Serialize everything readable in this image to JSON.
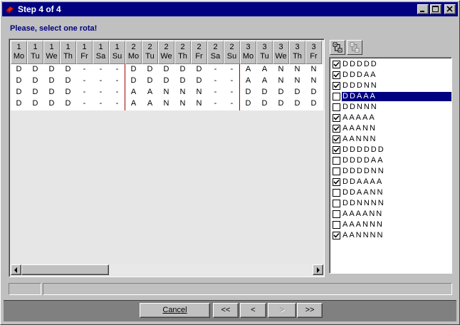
{
  "window": {
    "title": "Step 4 of 4"
  },
  "instruction": "Please, select one rota!",
  "grid": {
    "headers": [
      {
        "week": "1",
        "day": "Mo"
      },
      {
        "week": "1",
        "day": "Tu"
      },
      {
        "week": "1",
        "day": "We"
      },
      {
        "week": "1",
        "day": "Th"
      },
      {
        "week": "1",
        "day": "Fr"
      },
      {
        "week": "1",
        "day": "Sa"
      },
      {
        "week": "1",
        "day": "Su"
      },
      {
        "week": "2",
        "day": "Mo"
      },
      {
        "week": "2",
        "day": "Tu"
      },
      {
        "week": "2",
        "day": "We"
      },
      {
        "week": "2",
        "day": "Th"
      },
      {
        "week": "2",
        "day": "Fr"
      },
      {
        "week": "2",
        "day": "Sa"
      },
      {
        "week": "2",
        "day": "Su"
      },
      {
        "week": "3",
        "day": "Mo"
      },
      {
        "week": "3",
        "day": "Tu"
      },
      {
        "week": "3",
        "day": "We"
      },
      {
        "week": "3",
        "day": "Th"
      },
      {
        "week": "3",
        "day": "Fr"
      }
    ],
    "rows": [
      [
        "D",
        "D",
        "D",
        "D",
        "-",
        "-",
        "-",
        "D",
        "D",
        "D",
        "D",
        "D",
        "-",
        "-",
        "A",
        "A",
        "N",
        "N",
        "N"
      ],
      [
        "D",
        "D",
        "D",
        "D",
        "-",
        "-",
        "-",
        "D",
        "D",
        "D",
        "D",
        "D",
        "-",
        "-",
        "A",
        "A",
        "N",
        "N",
        "N"
      ],
      [
        "D",
        "D",
        "D",
        "D",
        "-",
        "-",
        "-",
        "A",
        "A",
        "N",
        "N",
        "N",
        "-",
        "-",
        "D",
        "D",
        "D",
        "D",
        "D"
      ],
      [
        "D",
        "D",
        "D",
        "D",
        "-",
        "-",
        "-",
        "A",
        "A",
        "N",
        "N",
        "N",
        "-",
        "-",
        "D",
        "D",
        "D",
        "D",
        "D"
      ]
    ]
  },
  "rotas": [
    {
      "label": "DDDDD",
      "checked": true,
      "selected": false
    },
    {
      "label": "DDDAA",
      "checked": true,
      "selected": false
    },
    {
      "label": "DDDNN",
      "checked": true,
      "selected": false
    },
    {
      "label": "DDAAA",
      "checked": false,
      "selected": true
    },
    {
      "label": "DDNNN",
      "checked": false,
      "selected": false
    },
    {
      "label": "AAAAA",
      "checked": true,
      "selected": false
    },
    {
      "label": "AAANN",
      "checked": true,
      "selected": false
    },
    {
      "label": "AANNN",
      "checked": true,
      "selected": false
    },
    {
      "label": "DDDDDD",
      "checked": true,
      "selected": false
    },
    {
      "label": "DDDDAA",
      "checked": false,
      "selected": false
    },
    {
      "label": "DDDDNN",
      "checked": false,
      "selected": false
    },
    {
      "label": "DDAAAA",
      "checked": true,
      "selected": false
    },
    {
      "label": "DDAANN",
      "checked": false,
      "selected": false
    },
    {
      "label": "DDNNNN",
      "checked": false,
      "selected": false
    },
    {
      "label": "AAAANN",
      "checked": false,
      "selected": false
    },
    {
      "label": "AAANNN",
      "checked": false,
      "selected": false
    },
    {
      "label": "AANNNN",
      "checked": true,
      "selected": false
    }
  ],
  "buttons": {
    "cancel": "Cancel",
    "first": "<<",
    "prev": "<",
    "next": ">",
    "last": ">>"
  },
  "icons": {
    "app": "app-logo-icon",
    "expand_all": "expand-tree-icon",
    "collapse_all": "collapse-tree-icon"
  }
}
